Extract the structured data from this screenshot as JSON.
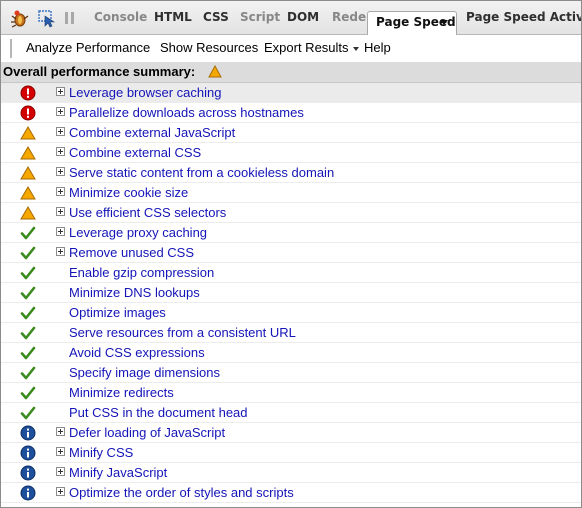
{
  "tabs": [
    {
      "label": "Console",
      "color": "#878787"
    },
    {
      "label": "HTML",
      "color": "#2f2f2f"
    },
    {
      "label": "CSS",
      "color": "#2f2f2f"
    },
    {
      "label": "Script",
      "color": "#878787"
    },
    {
      "label": "DOM",
      "color": "#2f2f2f"
    },
    {
      "label": "Rede",
      "color": "#878787"
    },
    {
      "label": "Page Speed",
      "active": true
    },
    {
      "label": "Page Speed Activity",
      "color": "#2f2f2f"
    }
  ],
  "menu": {
    "analyze": "Analyze Performance",
    "show_resources": "Show Resources",
    "export_results": "Export Results",
    "help": "Help"
  },
  "summary": {
    "title": "Overall performance summary:",
    "icon": "warning-icon"
  },
  "rules": [
    {
      "label": "Leverage browser caching",
      "status": "error",
      "expandable": true
    },
    {
      "label": "Parallelize downloads across hostnames",
      "status": "error",
      "expandable": true
    },
    {
      "label": "Combine external JavaScript",
      "status": "warning",
      "expandable": true
    },
    {
      "label": "Combine external CSS",
      "status": "warning",
      "expandable": true
    },
    {
      "label": "Serve static content from a cookieless domain",
      "status": "warning",
      "expandable": true
    },
    {
      "label": "Minimize cookie size",
      "status": "warning",
      "expandable": true
    },
    {
      "label": "Use efficient CSS selectors",
      "status": "warning",
      "expandable": true
    },
    {
      "label": "Leverage proxy caching",
      "status": "pass",
      "expandable": true
    },
    {
      "label": "Remove unused CSS",
      "status": "pass",
      "expandable": true
    },
    {
      "label": "Enable gzip compression",
      "status": "pass",
      "expandable": false
    },
    {
      "label": "Minimize DNS lookups",
      "status": "pass",
      "expandable": false
    },
    {
      "label": "Optimize images",
      "status": "pass",
      "expandable": false
    },
    {
      "label": "Serve resources from a consistent URL",
      "status": "pass",
      "expandable": false
    },
    {
      "label": "Avoid CSS expressions",
      "status": "pass",
      "expandable": false
    },
    {
      "label": "Specify image dimensions",
      "status": "pass",
      "expandable": false
    },
    {
      "label": "Minimize redirects",
      "status": "pass",
      "expandable": false
    },
    {
      "label": "Put CSS in the document head",
      "status": "pass",
      "expandable": false
    },
    {
      "label": "Defer loading of JavaScript",
      "status": "info",
      "expandable": true
    },
    {
      "label": "Minify CSS",
      "status": "info",
      "expandable": true
    },
    {
      "label": "Minify JavaScript",
      "status": "info",
      "expandable": true
    },
    {
      "label": "Optimize the order of styles and scripts",
      "status": "info",
      "expandable": true
    }
  ],
  "colors": {
    "error": "#d40000",
    "warning": "#f5a800",
    "pass": "#3a8a1e",
    "info": "#1d4f9a",
    "link": "#1414b8"
  }
}
